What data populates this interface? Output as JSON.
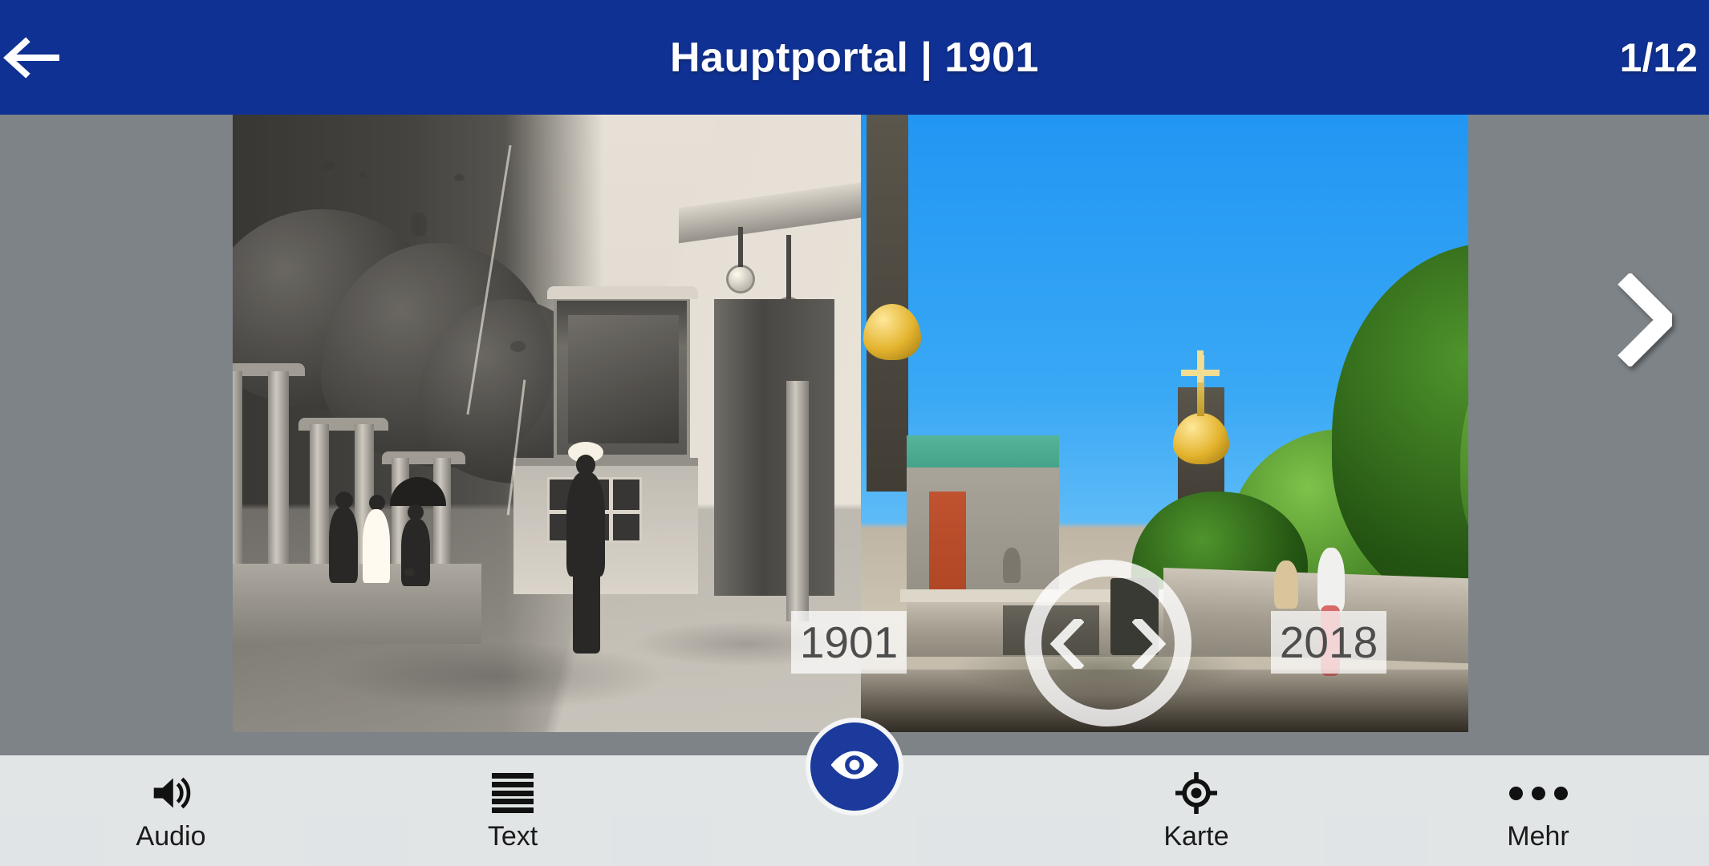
{
  "header": {
    "back_icon": "arrow-left-icon",
    "title": "Hauptportal | 1901",
    "counter": "1/12",
    "background_color": "#0f3193",
    "text_color": "#ffffff"
  },
  "stage": {
    "background_color": "#7d8387",
    "next_icon": "chevron-right-icon"
  },
  "comparison": {
    "left_year": "1901",
    "right_year": "2018",
    "split_handle_icon_left": "chevron-left-icon",
    "split_handle_icon_right": "chevron-right-icon",
    "left_photo_name": "historical-photo-1901",
    "right_photo_name": "modern-photo-2018"
  },
  "toolbar": {
    "background_color": "#eceff0",
    "items": [
      {
        "label": "Audio",
        "icon": "speaker-icon"
      },
      {
        "label": "Text",
        "icon": "text-lines-icon"
      },
      {
        "label": "Karte",
        "icon": "crosshair-icon"
      },
      {
        "label": "Mehr",
        "icon": "more-dots-icon"
      }
    ],
    "primary_action": {
      "icon": "eye-icon",
      "color": "#1b3a9c"
    }
  }
}
